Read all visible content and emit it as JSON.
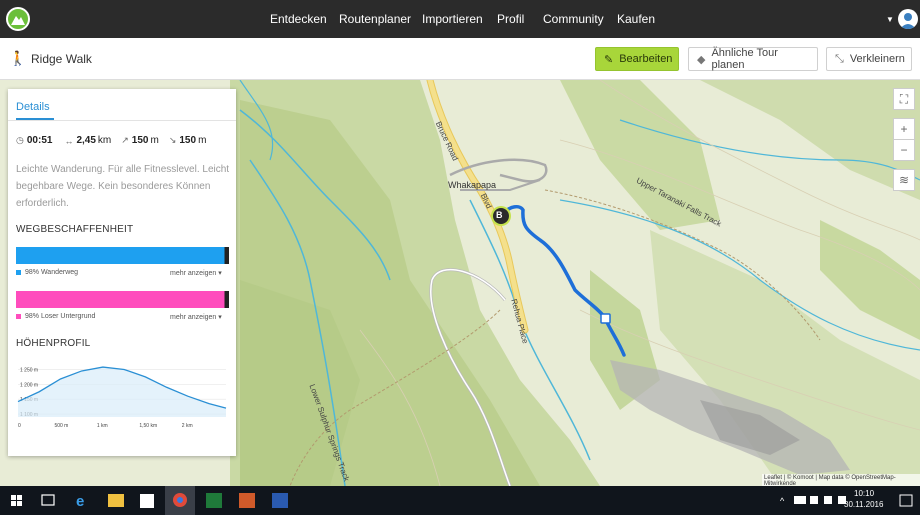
{
  "nav": {
    "items": [
      "Entdecken",
      "Routenplaner",
      "Importieren",
      "Profil",
      "Community",
      "Kaufen"
    ]
  },
  "tour": {
    "title": "Ridge Walk",
    "edit_label": "Bearbeiten",
    "plan_similar_label": "Ähnliche Tour planen",
    "shrink_label": "Verkleinern"
  },
  "panel": {
    "tab_label": "Details",
    "stats": {
      "duration": "00:51",
      "distance": "2,45",
      "distance_unit": "km",
      "ascent": "150",
      "ascent_unit": "m",
      "descent": "150",
      "descent_unit": "m"
    },
    "description": "Leichte Wanderung. Für alle Fitnesslevel. Leicht begehbare Wege. Kein besonderes Können erforderlich.",
    "surface_title": "WEGBESCHAFFENHEIT",
    "surface": [
      {
        "label": "98% Wanderweg",
        "color": "#1ea0f0",
        "share": 0.98,
        "more": "mehr anzeigen"
      },
      {
        "label": "98% Loser Untergrund",
        "color": "#ff4dbd",
        "share": 0.98,
        "more": "mehr anzeigen"
      }
    ],
    "elevation_title": "HÖHENPROFIL"
  },
  "chart_data": {
    "type": "area",
    "title": "HÖHENPROFIL",
    "x_ticks": [
      "0",
      "500 m",
      "1 km",
      "1,50 km",
      "2 km"
    ],
    "y_ticks": [
      "1 250 m",
      "1 200 m",
      "1 150 m",
      "1 100 m"
    ],
    "x": [
      0,
      250,
      500,
      750,
      1000,
      1250,
      1500,
      1750,
      2000,
      2250,
      2450
    ],
    "y": [
      1142,
      1175,
      1218,
      1245,
      1258,
      1250,
      1225,
      1190,
      1160,
      1135,
      1120
    ],
    "xlim": [
      0,
      2450
    ],
    "ylim": [
      1090,
      1265
    ],
    "color": "#2a8fd4"
  },
  "map": {
    "labels": {
      "whakapapa": "Whakapapa",
      "bruce_road": "Bruce Road",
      "upper_taranaki": "Upper Taranaki Falls Track",
      "rehua_place": "Rehua Place",
      "lower_sulphur": "Lower Sulphur Springs Track",
      "blv": "Blvd"
    },
    "marker_label": "B",
    "attribution": "Leaflet | © Komoot | Map data © OpenStreetMap-Mitwirkende"
  },
  "taskbar": {
    "time": "10:10",
    "date": "30.11.2016"
  },
  "colors": {
    "route": "#1e6fd8",
    "accent": "#a8d63a",
    "navbg": "#2b2b2b"
  }
}
